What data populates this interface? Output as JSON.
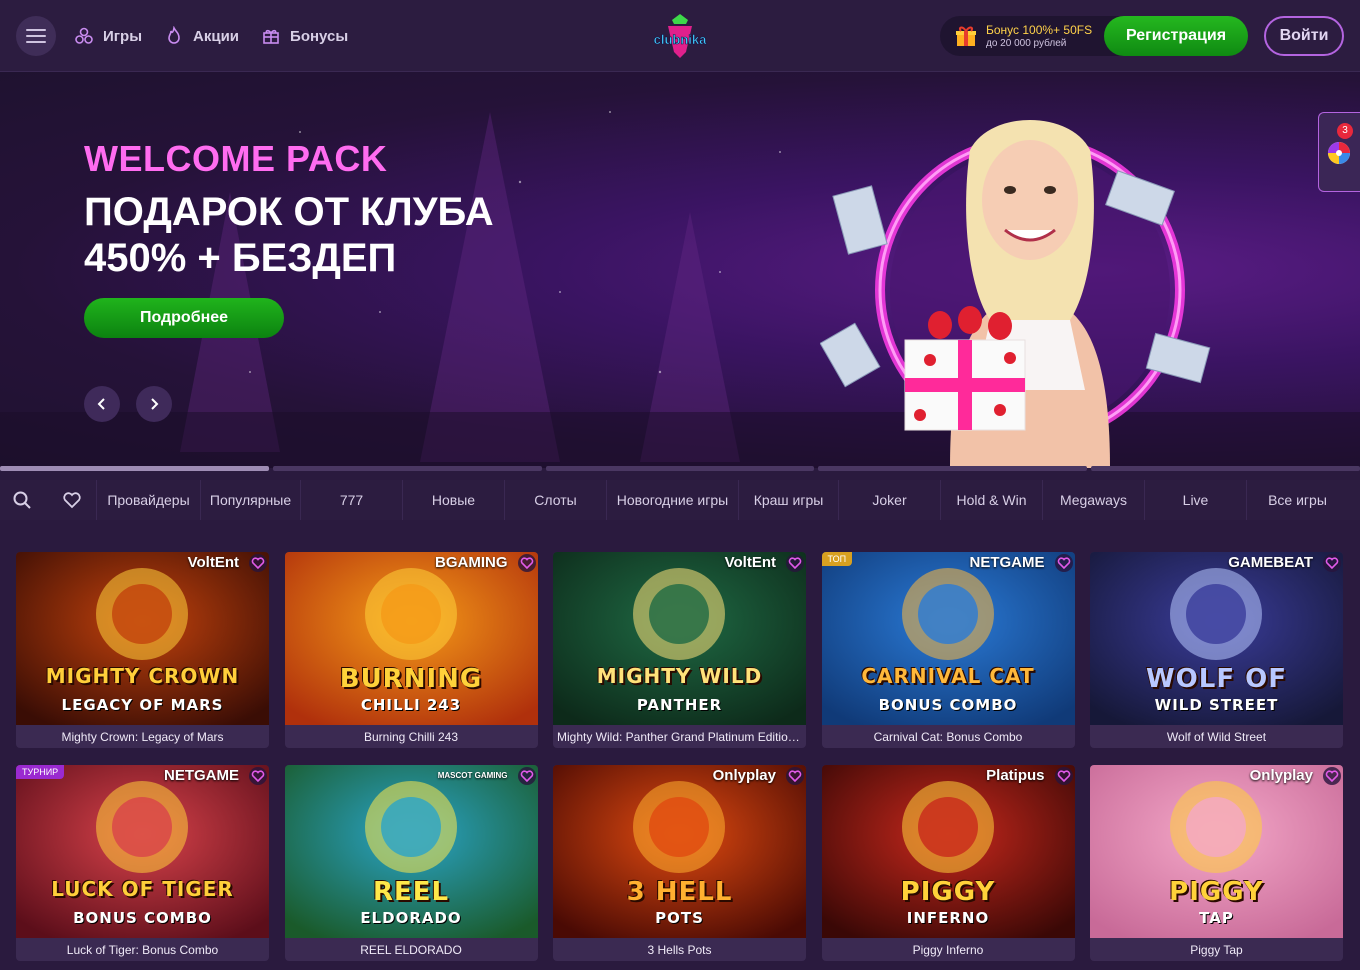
{
  "header": {
    "nav": [
      {
        "label": "Игры",
        "icon": "games-icon"
      },
      {
        "label": "Акции",
        "icon": "fire-icon"
      },
      {
        "label": "Бонусы",
        "icon": "gift-icon"
      }
    ],
    "logo_text": "clubnika",
    "bonus_line1": "Бонус 100%+ 50FS",
    "bonus_line2": "до 20 000 рублей",
    "register_label": "Регистрация",
    "login_label": "Войти"
  },
  "hero": {
    "kicker": "WELCOME PACK",
    "title": "ПОДАРОК ОТ КЛУБА",
    "subtitle": "450% + БЕЗДЕП",
    "button_label": "Подробнее",
    "slide_count": 5,
    "active_slide": 1
  },
  "side_widget": {
    "badge": "3"
  },
  "categories": [
    "Провайдеры",
    "Популярные",
    "777",
    "Новые",
    "Слоты",
    "Новогодние игры",
    "Краш игры",
    "Joker",
    "Hold & Win",
    "Megaways",
    "Live",
    "Все игры"
  ],
  "games": [
    {
      "title": "Mighty Crown: Legacy of Mars",
      "provider": "VoltEnt",
      "tag": "",
      "art1": "MIGHTY CROWN",
      "art2": "LEGACY OF MARS",
      "colors": [
        "#c2420c",
        "#3a0d05",
        "#ffcf3a"
      ]
    },
    {
      "title": "Burning Chilli 243",
      "provider": "BGAMING",
      "tag": "",
      "art1": "BURNING",
      "art2": "CHILLI 243",
      "colors": [
        "#f59a18",
        "#b0300c",
        "#ffd23a"
      ]
    },
    {
      "title": "Mighty Wild: Panther Grand Platinum Edition Santa's Jackpots",
      "provider": "VoltEnt",
      "tag": "",
      "art1": "MIGHTY WILD",
      "art2": "PANTHER",
      "colors": [
        "#1f6a44",
        "#0d2a1a",
        "#ffe27a"
      ]
    },
    {
      "title": "Carnival Cat: Bonus Combo",
      "provider": "NETGAME",
      "tag": "ТОП",
      "art1": "CARNIVAL CAT",
      "art2": "BONUS COMBO",
      "colors": [
        "#2a7ad6",
        "#103a78",
        "#ffb83a"
      ]
    },
    {
      "title": "Wolf of Wild Street",
      "provider": "GAMEBEAT",
      "tag": "",
      "art1": "WOLF OF",
      "art2": "WILD STREET",
      "colors": [
        "#3a3c9a",
        "#161838",
        "#b8c8ff"
      ]
    },
    {
      "title": "Luck of Tiger: Bonus Combo",
      "provider": "NETGAME",
      "tag": "ТУРНИР",
      "art1": "LUCK OF TIGER",
      "art2": "BONUS COMBO",
      "colors": [
        "#d8424a",
        "#5c0e1a",
        "#ffcf3a"
      ]
    },
    {
      "title": "REEL ELDORADO",
      "provider": "MASCOT GAMING",
      "tag": "",
      "art1": "REEL",
      "art2": "ELDORADO",
      "colors": [
        "#2aa4c8",
        "#1a5a2a",
        "#ffe84a"
      ]
    },
    {
      "title": "3 Hells Pots",
      "provider": "Onlyplay",
      "tag": "",
      "art1": "3 HELL",
      "art2": "POTS",
      "colors": [
        "#e04a10",
        "#4a0a04",
        "#ffb030"
      ]
    },
    {
      "title": "Piggy Inferno",
      "provider": "Platipus",
      "tag": "",
      "art1": "PIGGY",
      "art2": "INFERNO",
      "colors": [
        "#c8281c",
        "#3a0806",
        "#ffd23a"
      ]
    },
    {
      "title": "Piggy Tap",
      "provider": "Onlyplay",
      "tag": "",
      "art1": "PIGGY",
      "art2": "TAP",
      "colors": [
        "#f4a8c8",
        "#c86a98",
        "#ffd23a"
      ]
    }
  ]
}
